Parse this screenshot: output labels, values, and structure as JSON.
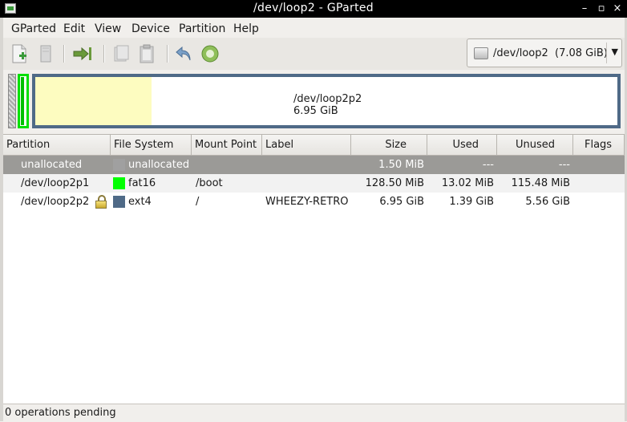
{
  "window": {
    "title": "/dev/loop2 - GParted"
  },
  "menu": [
    {
      "label": "GParted"
    },
    {
      "label": "Edit"
    },
    {
      "label": "View"
    },
    {
      "label": "Device"
    },
    {
      "label": "Partition"
    },
    {
      "label": "Help"
    }
  ],
  "device": {
    "name": "/dev/loop2",
    "size": "(7.08 GiB)"
  },
  "diskmap": {
    "ext4_name": "/dev/loop2p2",
    "ext4_size": "6.95 GiB",
    "ext4_used_fraction": 0.2
  },
  "table": {
    "headers": [
      "Partition",
      "File System",
      "Mount Point",
      "Label",
      "Size",
      "Used",
      "Unused",
      "Flags"
    ],
    "rows": [
      {
        "partition": "unallocated",
        "fs": "unallocated",
        "fs_color": "#a0a0a0",
        "mount": "",
        "label": "",
        "size": "1.50 MiB",
        "used": "---",
        "unused": "---",
        "flags": ""
      },
      {
        "partition": "/dev/loop2p1",
        "fs": "fat16",
        "fs_color": "#00ff00",
        "mount": "/boot",
        "label": "",
        "size": "128.50 MiB",
        "used": "13.02 MiB",
        "unused": "115.48 MiB",
        "flags": ""
      },
      {
        "partition": "/dev/loop2p2",
        "fs": "ext4",
        "fs_color": "#4f6a87",
        "mount": "/",
        "label": "WHEEZY-RETRO",
        "size": "6.95 GiB",
        "used": "1.39 GiB",
        "unused": "5.56 GiB",
        "flags": ""
      }
    ]
  },
  "status": {
    "text": "0 operations pending"
  }
}
